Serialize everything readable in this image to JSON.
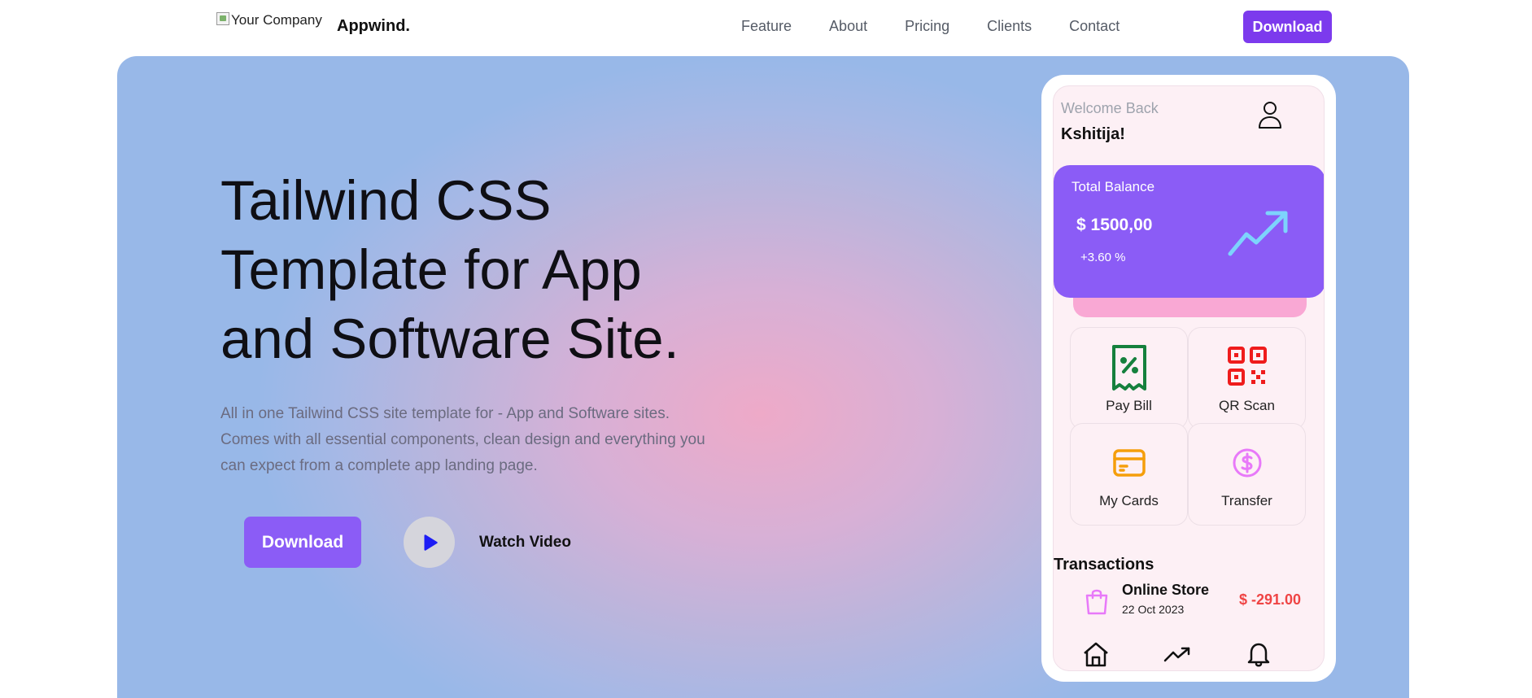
{
  "nav": {
    "logo_alt": "Your Company",
    "brand": "Appwind.",
    "links": [
      "Feature",
      "About",
      "Pricing",
      "Clients",
      "Contact"
    ],
    "download_label": "Download"
  },
  "hero": {
    "title_lines": [
      "Tailwind CSS",
      "Template for App",
      "and Software Site."
    ],
    "subtitle_lines": [
      "All in one Tailwind CSS site template for - App and Software sites.",
      "Comes with all essential components, clean design and everything you",
      "can expect from a complete app landing page."
    ],
    "download_label": "Download",
    "watch_label": "Watch Video"
  },
  "phone": {
    "welcome": "Welcome Back",
    "username": "Kshitija!",
    "balance": {
      "label": "Total Balance",
      "value": "$ 1500,00",
      "change": "+3.60 %"
    },
    "tiles": [
      {
        "label": "Pay Bill",
        "icon": "receipt-percent-icon",
        "color": "#15803d"
      },
      {
        "label": "QR Scan",
        "icon": "qr-code-icon",
        "color": "#ef1c1c"
      },
      {
        "label": "My Cards",
        "icon": "credit-card-icon",
        "color": "#f59e0b"
      },
      {
        "label": "Transfer",
        "icon": "dollar-circle-icon",
        "color": "#e879f9"
      }
    ],
    "transactions_title": "Transactions",
    "transaction": {
      "name": "Online Store",
      "date": "22 Oct 2023",
      "amount": "$ -291.00"
    },
    "bottom_nav": [
      "home-icon",
      "trending-icon",
      "bell-icon"
    ]
  },
  "colors": {
    "accent": "#7c3aed",
    "button": "#8b5cf6",
    "negative": "#ef4444"
  }
}
